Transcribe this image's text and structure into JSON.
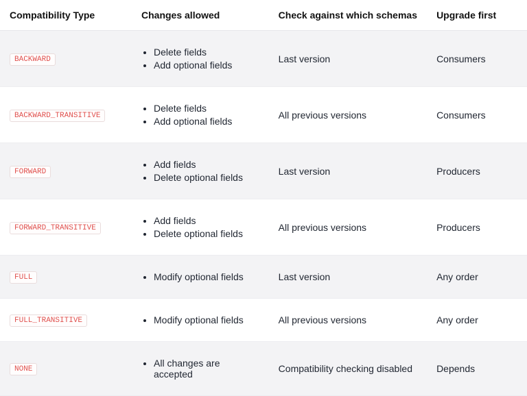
{
  "table": {
    "headers": [
      "Compatibility Type",
      "Changes allowed",
      "Check against which schemas",
      "Upgrade first"
    ],
    "rows": [
      {
        "type": "BACKWARD",
        "changes": [
          "Delete fields",
          "Add optional fields"
        ],
        "check": "Last version",
        "upgrade": "Consumers"
      },
      {
        "type": "BACKWARD_TRANSITIVE",
        "changes": [
          "Delete fields",
          "Add optional fields"
        ],
        "check": "All previous versions",
        "upgrade": "Consumers"
      },
      {
        "type": "FORWARD",
        "changes": [
          "Add fields",
          "Delete optional fields"
        ],
        "check": "Last version",
        "upgrade": "Producers"
      },
      {
        "type": "FORWARD_TRANSITIVE",
        "changes": [
          "Add fields",
          "Delete optional fields"
        ],
        "check": "All previous versions",
        "upgrade": "Producers"
      },
      {
        "type": "FULL",
        "changes": [
          "Modify optional fields"
        ],
        "check": "Last version",
        "upgrade": "Any order"
      },
      {
        "type": "FULL_TRANSITIVE",
        "changes": [
          "Modify optional fields"
        ],
        "check": "All previous versions",
        "upgrade": "Any order"
      },
      {
        "type": "NONE",
        "changes": [
          "All changes are accepted"
        ],
        "check": "Compatibility checking disabled",
        "upgrade": "Depends"
      }
    ]
  }
}
